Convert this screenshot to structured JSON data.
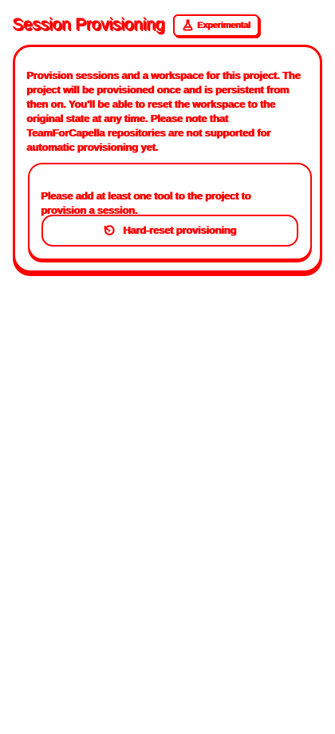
{
  "colors": {
    "accent": "#ff0000",
    "background": "#ffffff"
  },
  "header": {
    "title": "Session Provisioning",
    "badge": {
      "label": "Experimental",
      "icon": "flask-icon"
    }
  },
  "card": {
    "description": "Provision sessions and a workspace for this project. The project will be provisioned once and is persistent from then on. You'll be able to reset the workspace to the original state at any time. Please note that TeamForCapella repositories are not supported for automatic provisioning yet.",
    "inner": {
      "message": "Please add at least one tool to the project to provision a session.",
      "button": {
        "label": "Hard-reset provisioning",
        "icon": "reset-icon"
      }
    }
  }
}
